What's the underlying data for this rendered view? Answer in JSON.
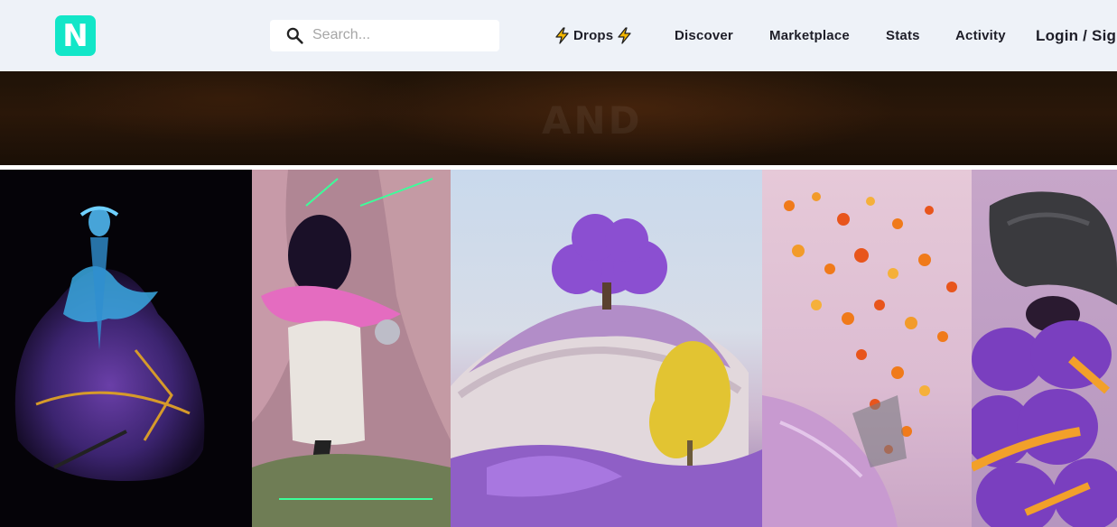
{
  "header": {
    "logo_letter": "N",
    "search": {
      "placeholder": "Search..."
    },
    "nav": {
      "drops": "Drops",
      "discover": "Discover",
      "marketplace": "Marketplace",
      "stats": "Stats",
      "activity": "Activity",
      "login": "Login / Sign"
    }
  },
  "banner": {
    "text": "AND"
  },
  "icons": {
    "search": "search-icon",
    "bolt": "lightning-bolt-icon"
  },
  "colors": {
    "header_bg": "#eef2f8",
    "logo_bg": "#12e6c8",
    "bolt": "#f5b800"
  }
}
